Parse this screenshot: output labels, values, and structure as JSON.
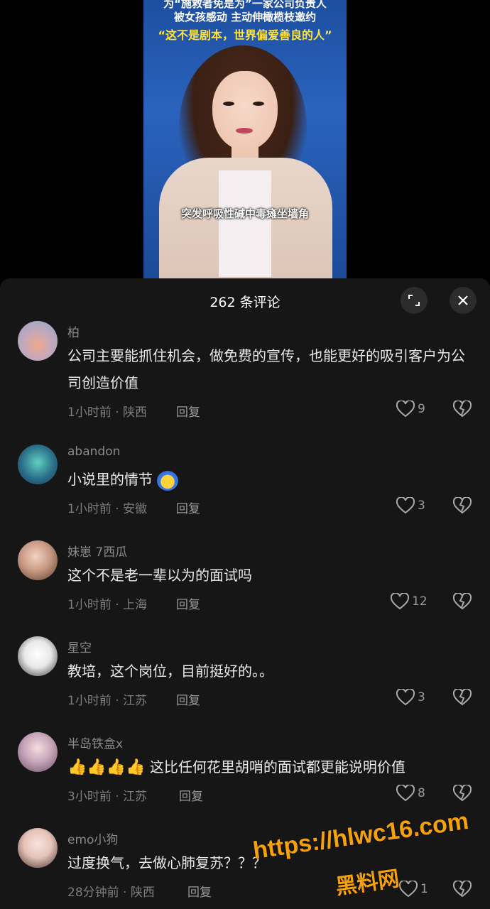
{
  "video": {
    "headline_line1": "为“施救者免是为”一家公司负责人",
    "headline_line2": "被女孩感动 主动伸橄榄枝邀约",
    "headline_line3": "“这不是剧本，世界偏爱善良的人”",
    "subtitle": "突发呼吸性碱中毒瘫坐墙角"
  },
  "panel": {
    "title": "262 条评论",
    "expand_icon": "expand-icon",
    "close_icon": "close-icon"
  },
  "reply_label": "回复",
  "comments": [
    {
      "username": "柏",
      "text": "公司主要能抓住机会，做免费的宣传，也能更好的吸引客户为公司创造价值",
      "meta": "1小时前 · 陕西",
      "likes": "9"
    },
    {
      "username": "abandon",
      "text": "小说里的情节",
      "meta": "1小时前 · 安徽",
      "likes": "3"
    },
    {
      "username": "妹崽 7西瓜",
      "text": "这个不是老一辈以为的面试吗",
      "meta": "1小时前 · 上海",
      "likes": "12"
    },
    {
      "username": "星空",
      "text": "教培，这个岗位，目前挺好的。。",
      "meta": "1小时前 · 江苏",
      "likes": "3"
    },
    {
      "username": "半岛铁盒x",
      "text": "这比任何花里胡哨的面试都更能说明价值",
      "meta": "3小时前 · 江苏",
      "likes": "8"
    },
    {
      "username": "emo小狗",
      "text": "过度换气，去做心肺复苏？？？",
      "meta": "28分钟前 · 陕西",
      "likes": "1"
    }
  ],
  "watermark": {
    "line1": "https://hlwc16.com",
    "line2": "黑料网"
  },
  "colors": {
    "panel_bg": "#161616",
    "watermark": "#f5a10a"
  }
}
